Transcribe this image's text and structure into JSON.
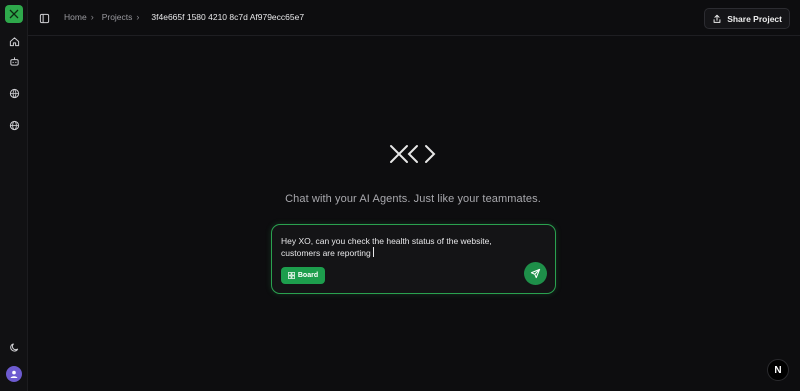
{
  "app": {
    "brand_color": "#2ea84b",
    "accent_color": "#1d9e4d"
  },
  "sidebar": {
    "items": [
      {
        "name": "home",
        "icon": "home-icon"
      },
      {
        "name": "agents",
        "icon": "bot-icon"
      },
      {
        "name": "integrations",
        "icon": "globe-grid-icon"
      },
      {
        "name": "web",
        "icon": "globe-icon"
      }
    ],
    "bottom": [
      {
        "name": "theme",
        "icon": "moon-icon"
      },
      {
        "name": "user",
        "icon": "avatar"
      }
    ]
  },
  "header": {
    "breadcrumb": [
      {
        "label": "Home"
      },
      {
        "label": "Projects"
      }
    ],
    "current": "3f4e665f 1580 4210 8c7d Af979ecc65e7",
    "share_label": "Share Project"
  },
  "main": {
    "tagline": "Chat with your AI Agents. Just like your teammates.",
    "composer": {
      "value": "Hey XO, can you check the health status of the website, customers are reporting",
      "board_label": "Board"
    }
  },
  "badge": {
    "letter": "N"
  }
}
